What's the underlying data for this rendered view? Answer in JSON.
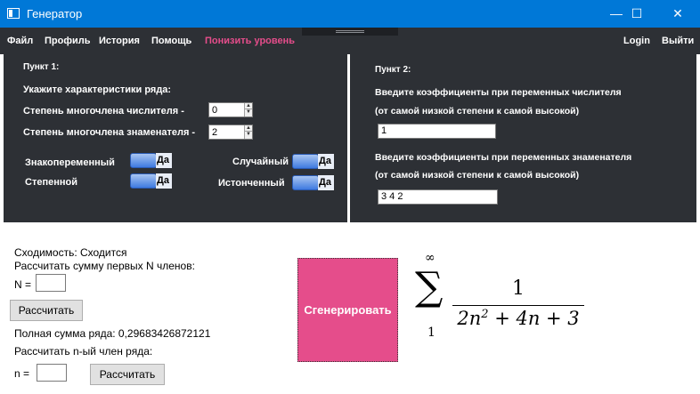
{
  "window": {
    "title": "Генератор",
    "minimize": "—",
    "maximize": "☐",
    "close": "✕"
  },
  "menu": {
    "file": "Файл",
    "profile": "Профиль",
    "history": "История",
    "help": "Помощь",
    "lower_level": "Понизить уровень",
    "login": "Login",
    "exit": "Выйти",
    "accent_color": "#e54d8b"
  },
  "section1": {
    "heading": "Пункт 1:",
    "subheading": "Укажите характеристики ряда:",
    "numerator_degree_label": "Степень многочлена числителя -",
    "numerator_degree_value": "0",
    "denominator_degree_label": "Степень многочлена знаменателя -",
    "denominator_degree_value": "2",
    "alternating_label": "Знакопеременный",
    "alternating_value": "Да",
    "power_label": "Степенной",
    "power_value": "Да",
    "random_label": "Случайный",
    "random_value": "Да",
    "thinned_label": "Истонченный",
    "thinned_value": "Да"
  },
  "section2": {
    "heading": "Пункт 2:",
    "numerator_prompt": "Введите коэффициенты при переменных числителя",
    "order_hint_1": "(от самой низкой степени к самой высокой)",
    "numerator_value": "1",
    "denominator_prompt": "Введите коэффициенты при переменных знаменателя",
    "order_hint_2": "(от самой низкой степени к самой высокой)",
    "denominator_value": "3 4 2"
  },
  "results": {
    "convergence": "Сходимость: Сходится",
    "sum_first_n_label": "Рассчитать сумму первых N членов:",
    "n_upper_label": "N =",
    "n_upper_value": "",
    "calculate_button_1": "Рассчитать",
    "full_sum": "Полная сумма ряда: 0,29683426872121",
    "nth_term_label": "Рассчитать n-ый член ряда:",
    "n_lower_label": "n =",
    "n_lower_value": "",
    "calculate_button_2": "Рассчитать"
  },
  "generate_button": "Сгенерировать",
  "formula": {
    "sigma": "∑",
    "upper_limit": "∞",
    "lower_limit": "1",
    "numerator": "1",
    "den_part1": "2n",
    "den_exp": "2",
    "den_part2": " + 4n + 3"
  }
}
